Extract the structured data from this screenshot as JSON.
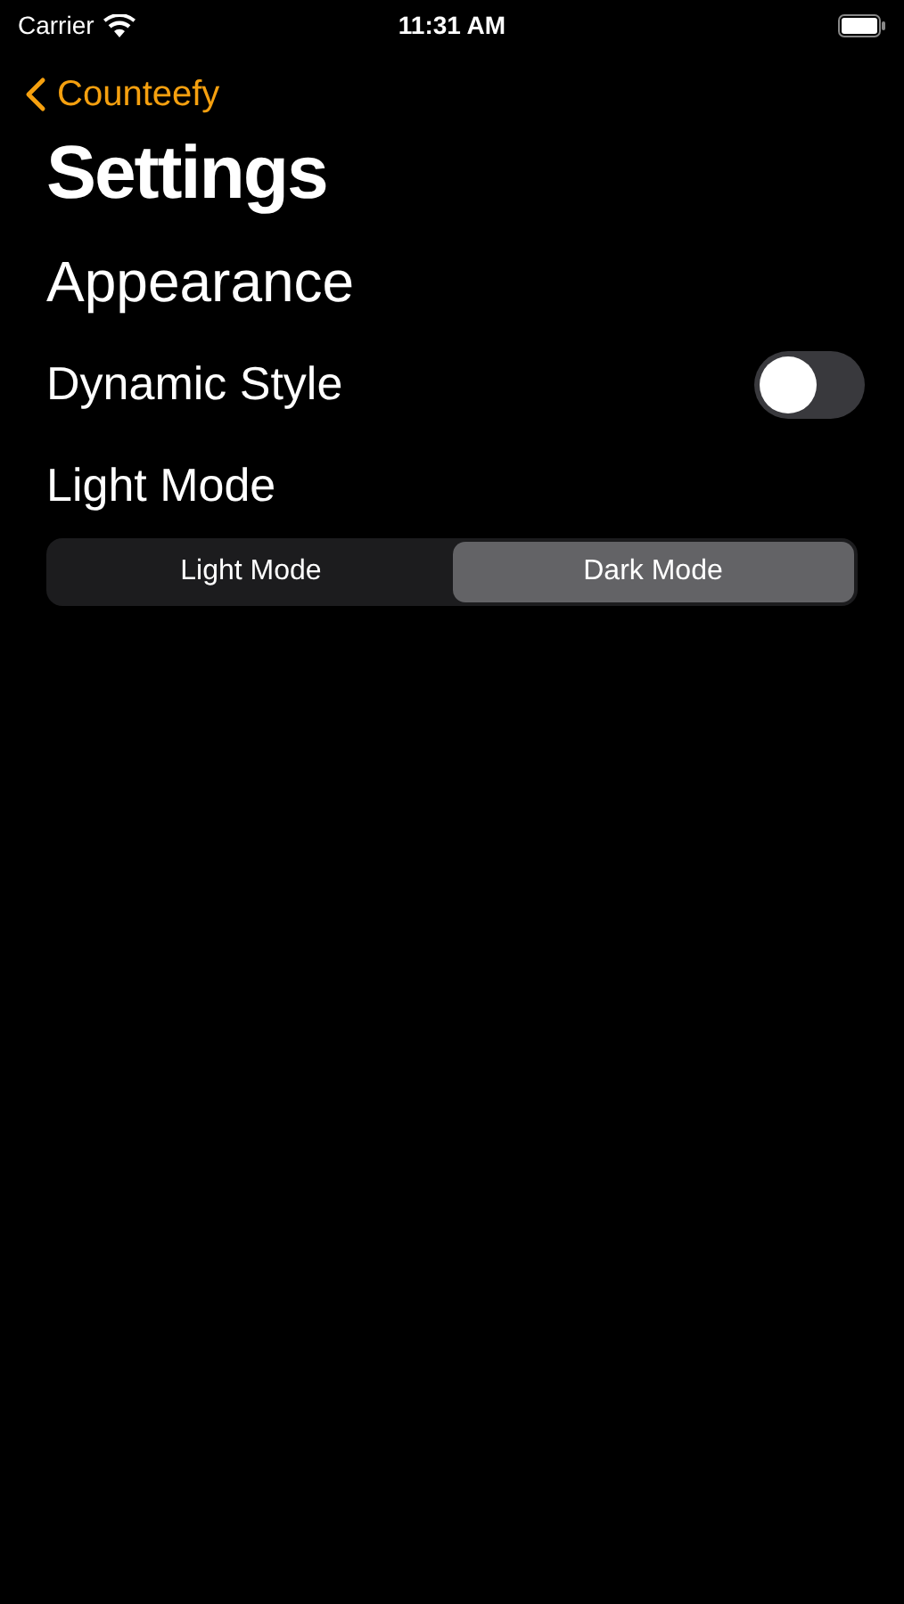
{
  "status_bar": {
    "carrier": "Carrier",
    "time": "11:31 AM"
  },
  "nav": {
    "back_label": "Counteefy"
  },
  "title": "Settings",
  "section": "Appearance",
  "toggle": {
    "label": "Dynamic Style",
    "on": false
  },
  "mode_label": "Light Mode",
  "segments": [
    {
      "label": "Light Mode",
      "selected": false
    },
    {
      "label": "Dark Mode",
      "selected": true
    }
  ]
}
